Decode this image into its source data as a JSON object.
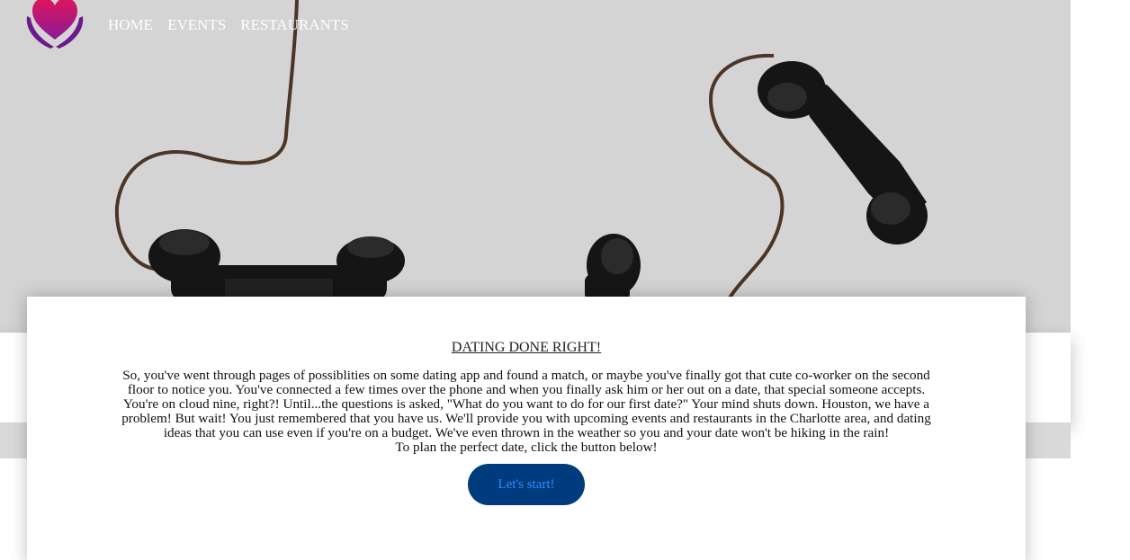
{
  "nav": {
    "items": [
      "HOME",
      "EVENTS",
      "RESTAURANTS"
    ]
  },
  "logo": {
    "icon": "heart-hands-logo"
  },
  "hero": {
    "image": "vintage-telephone-receivers"
  },
  "card": {
    "title": "DATING DONE RIGHT!",
    "body": "So, you've went through pages of possiblities on some dating app and found a match, or maybe you've finally got that cute co-worker on the second floor to notice you. You've connected a few times over the phone and when you finally ask him or her out on a date, that special someone accepts. You're on cloud nine, right?! Until...the questions is asked, \"What do you want to do for our first date?\" Your mind shuts down. Houston, we have a problem! But wait! You just remembered that you have us. We'll provide you with upcoming events and restaurants in the Charlotte area, and dating ideas that you can use even if you're on a budget. We've even thrown in the weather so you and your date won't be hiking in the rain!",
    "cta_text": "To plan the perfect date, click the button below!",
    "button_label": "Let's start!"
  },
  "colors": {
    "hero_bg": "#d4d4d4",
    "button_bg": "#003b7d",
    "button_text": "#2f8cff",
    "nav_text": "#ffffff"
  }
}
